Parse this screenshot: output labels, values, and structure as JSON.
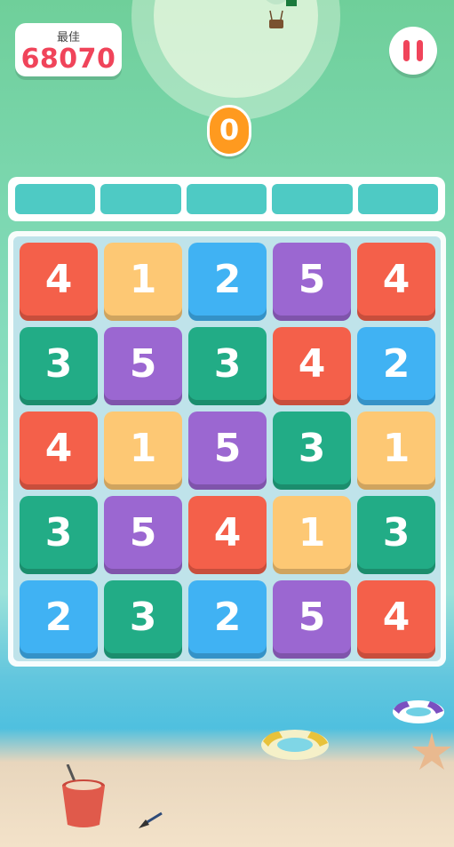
{
  "best": {
    "label": "最佳",
    "value": "68070"
  },
  "score": "0",
  "progress_segments": 5,
  "board": [
    [
      "4",
      "1",
      "2",
      "5",
      "4"
    ],
    [
      "3",
      "5",
      "3",
      "4",
      "2"
    ],
    [
      "4",
      "1",
      "5",
      "3",
      "1"
    ],
    [
      "3",
      "5",
      "4",
      "1",
      "3"
    ],
    [
      "2",
      "3",
      "2",
      "5",
      "4"
    ]
  ],
  "colors": {
    "1": "#fdc874",
    "2": "#40b2f3",
    "3": "#22ac86",
    "4": "#f4604a",
    "5": "#9b67d1",
    "accent_red": "#f0445a",
    "score_orange": "#ff9a1f"
  },
  "icons": {
    "pause": "pause-icon",
    "balloon": "hot-air-balloon-icon"
  }
}
